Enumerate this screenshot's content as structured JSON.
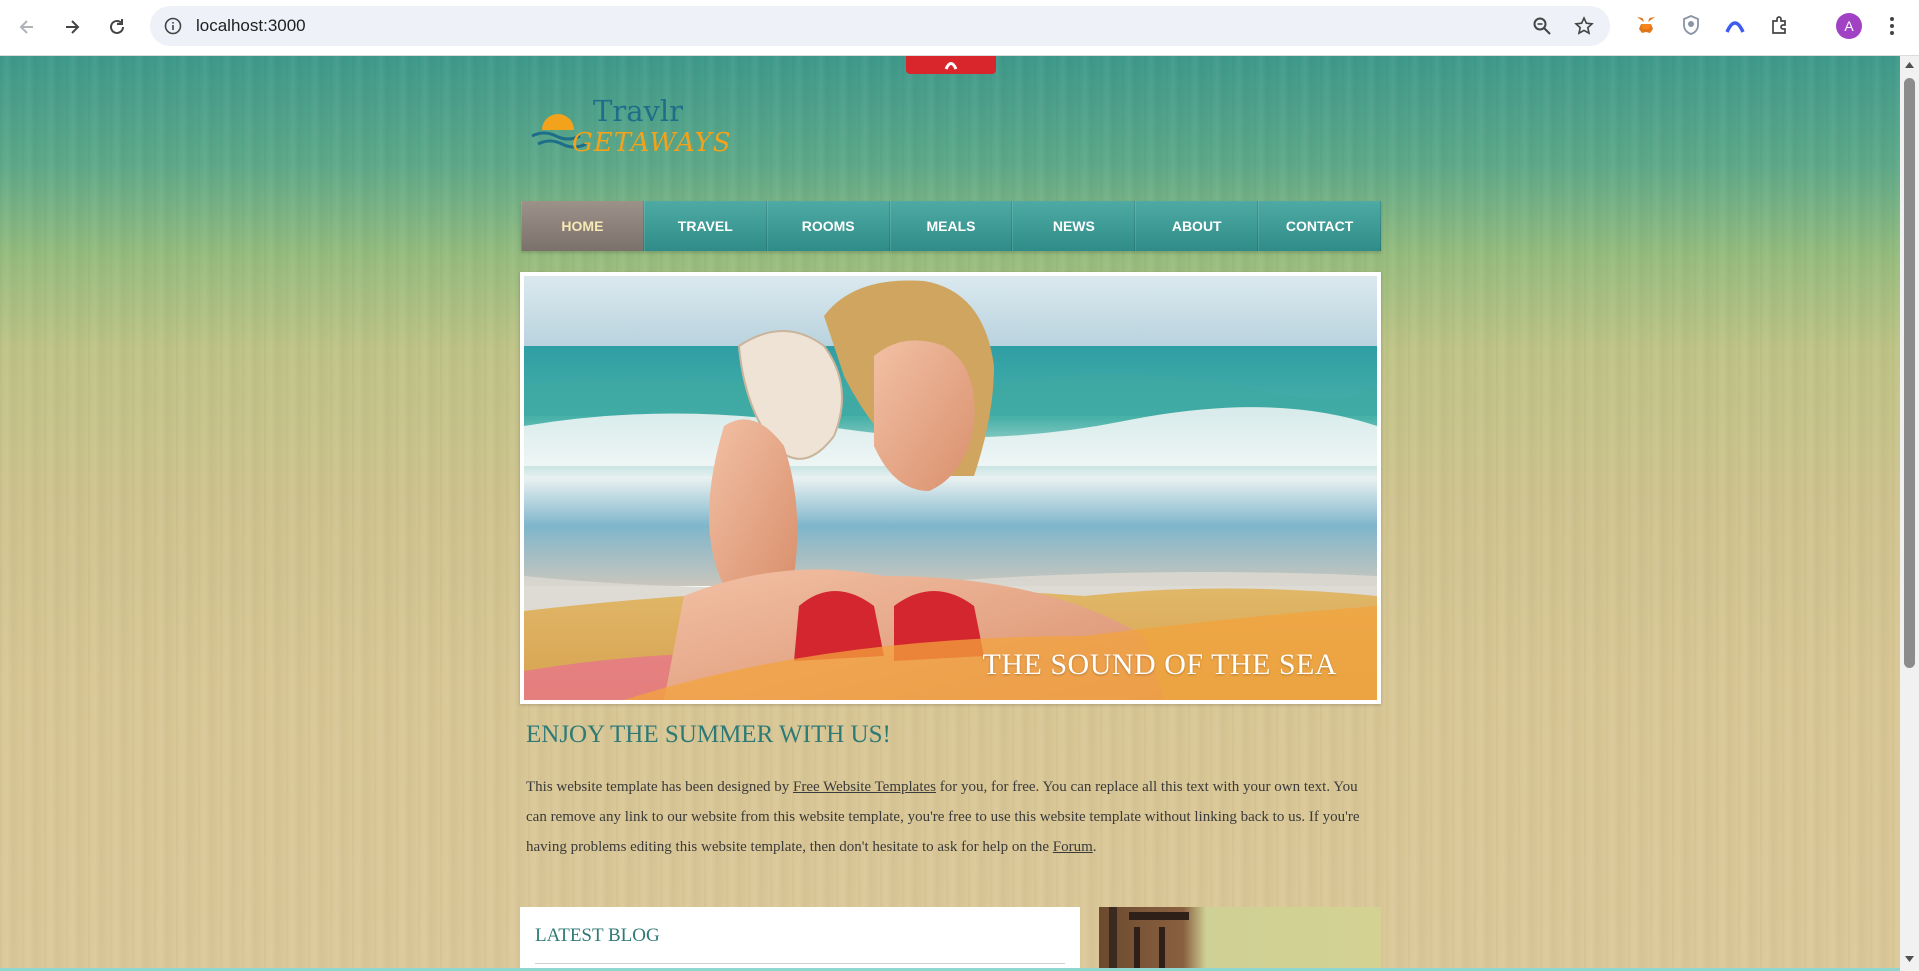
{
  "browser": {
    "url": "localhost:3000",
    "profile_initial": "A",
    "icons": [
      "back-icon",
      "forward-icon",
      "reload-icon",
      "info-icon",
      "zoom-icon",
      "star-icon",
      "metamask-icon",
      "shield-extension-icon",
      "arc-extension-icon",
      "puzzle-extension-icon",
      "menu-icon"
    ]
  },
  "site": {
    "logo": {
      "line1": "Travlr",
      "line2": "GETAWAYS"
    },
    "nav": [
      {
        "label": "HOME"
      },
      {
        "label": "TRAVEL"
      },
      {
        "label": "ROOMS"
      },
      {
        "label": "MEALS"
      },
      {
        "label": "NEWS"
      },
      {
        "label": "ABOUT"
      },
      {
        "label": "CONTACT"
      }
    ],
    "active_nav": "HOME",
    "hero": {
      "caption": "THE SOUND OF THE SEA"
    },
    "intro": {
      "heading": "ENJOY THE SUMMER WITH US!",
      "text_before_link": "This website template has been designed by ",
      "link1": "Free Website Templates",
      "text_middle": " for you, for free. You can replace all this text with your own text. You can remove any link to our website from this website template, you're free to use this website template without linking back to us. If you're having problems editing this website template, then don't hesitate to ask for help on the ",
      "link2": "Forum",
      "text_end": "."
    },
    "blog": {
      "title": "LATEST BLOG"
    }
  },
  "colors": {
    "nav_teal": "#3a9893",
    "nav_active": "#8a7f78",
    "heading_teal": "#2e7a76",
    "top_tab_red": "#d8262c"
  }
}
